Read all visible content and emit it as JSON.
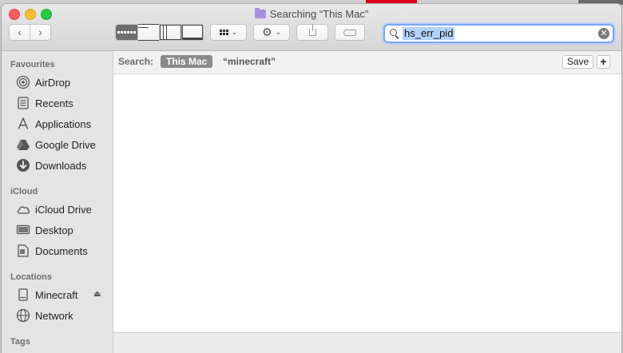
{
  "window": {
    "title": "Searching “This Mac”"
  },
  "toolbar": {
    "back_glyph": "‹",
    "forward_glyph": "›",
    "action_glyph": "⚙",
    "chevron": "⌄"
  },
  "search": {
    "value": "hs_err_pid",
    "clear_glyph": "✕"
  },
  "sidebar": {
    "favourites_label": "Favourites",
    "favourites": [
      {
        "label": "AirDrop",
        "icon": "airdrop-icon"
      },
      {
        "label": "Recents",
        "icon": "recents-icon"
      },
      {
        "label": "Applications",
        "icon": "applications-icon"
      },
      {
        "label": "Google Drive",
        "icon": "google-drive-icon"
      },
      {
        "label": "Downloads",
        "icon": "downloads-icon"
      }
    ],
    "icloud_label": "iCloud",
    "icloud": [
      {
        "label": "iCloud Drive",
        "icon": "cloud-icon"
      },
      {
        "label": "Desktop",
        "icon": "desktop-icon"
      },
      {
        "label": "Documents",
        "icon": "documents-icon"
      }
    ],
    "locations_label": "Locations",
    "locations": [
      {
        "label": "Minecraft",
        "icon": "disk-icon"
      },
      {
        "label": "Network",
        "icon": "network-icon"
      }
    ],
    "tags_label": "Tags",
    "eject_glyph": "⏏"
  },
  "scope": {
    "label": "Search:",
    "active": "This Mac",
    "other": "“minecraft”",
    "save_label": "Save",
    "add_glyph": "+"
  }
}
